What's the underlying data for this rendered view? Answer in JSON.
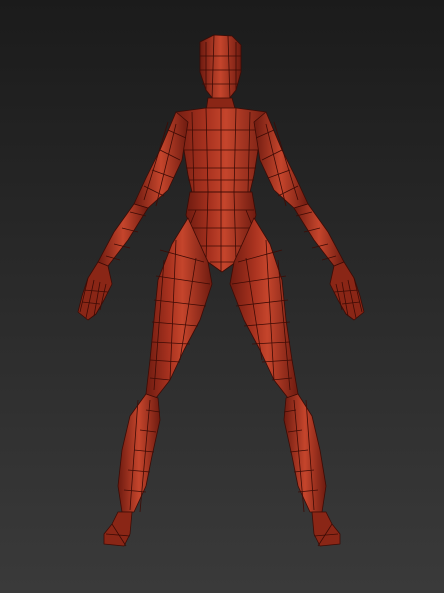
{
  "scene": {
    "subject": "low-poly-female-base-mesh",
    "view": "front",
    "pose": "a-pose",
    "colors": {
      "background_top": "#1b1b1b",
      "background_bottom": "#3a3a3a",
      "mesh_base": "#a8321f",
      "mesh_highlight": "#c5452c",
      "mesh_shadow": "#6e1b10",
      "wireframe": "#3d0b05"
    }
  }
}
